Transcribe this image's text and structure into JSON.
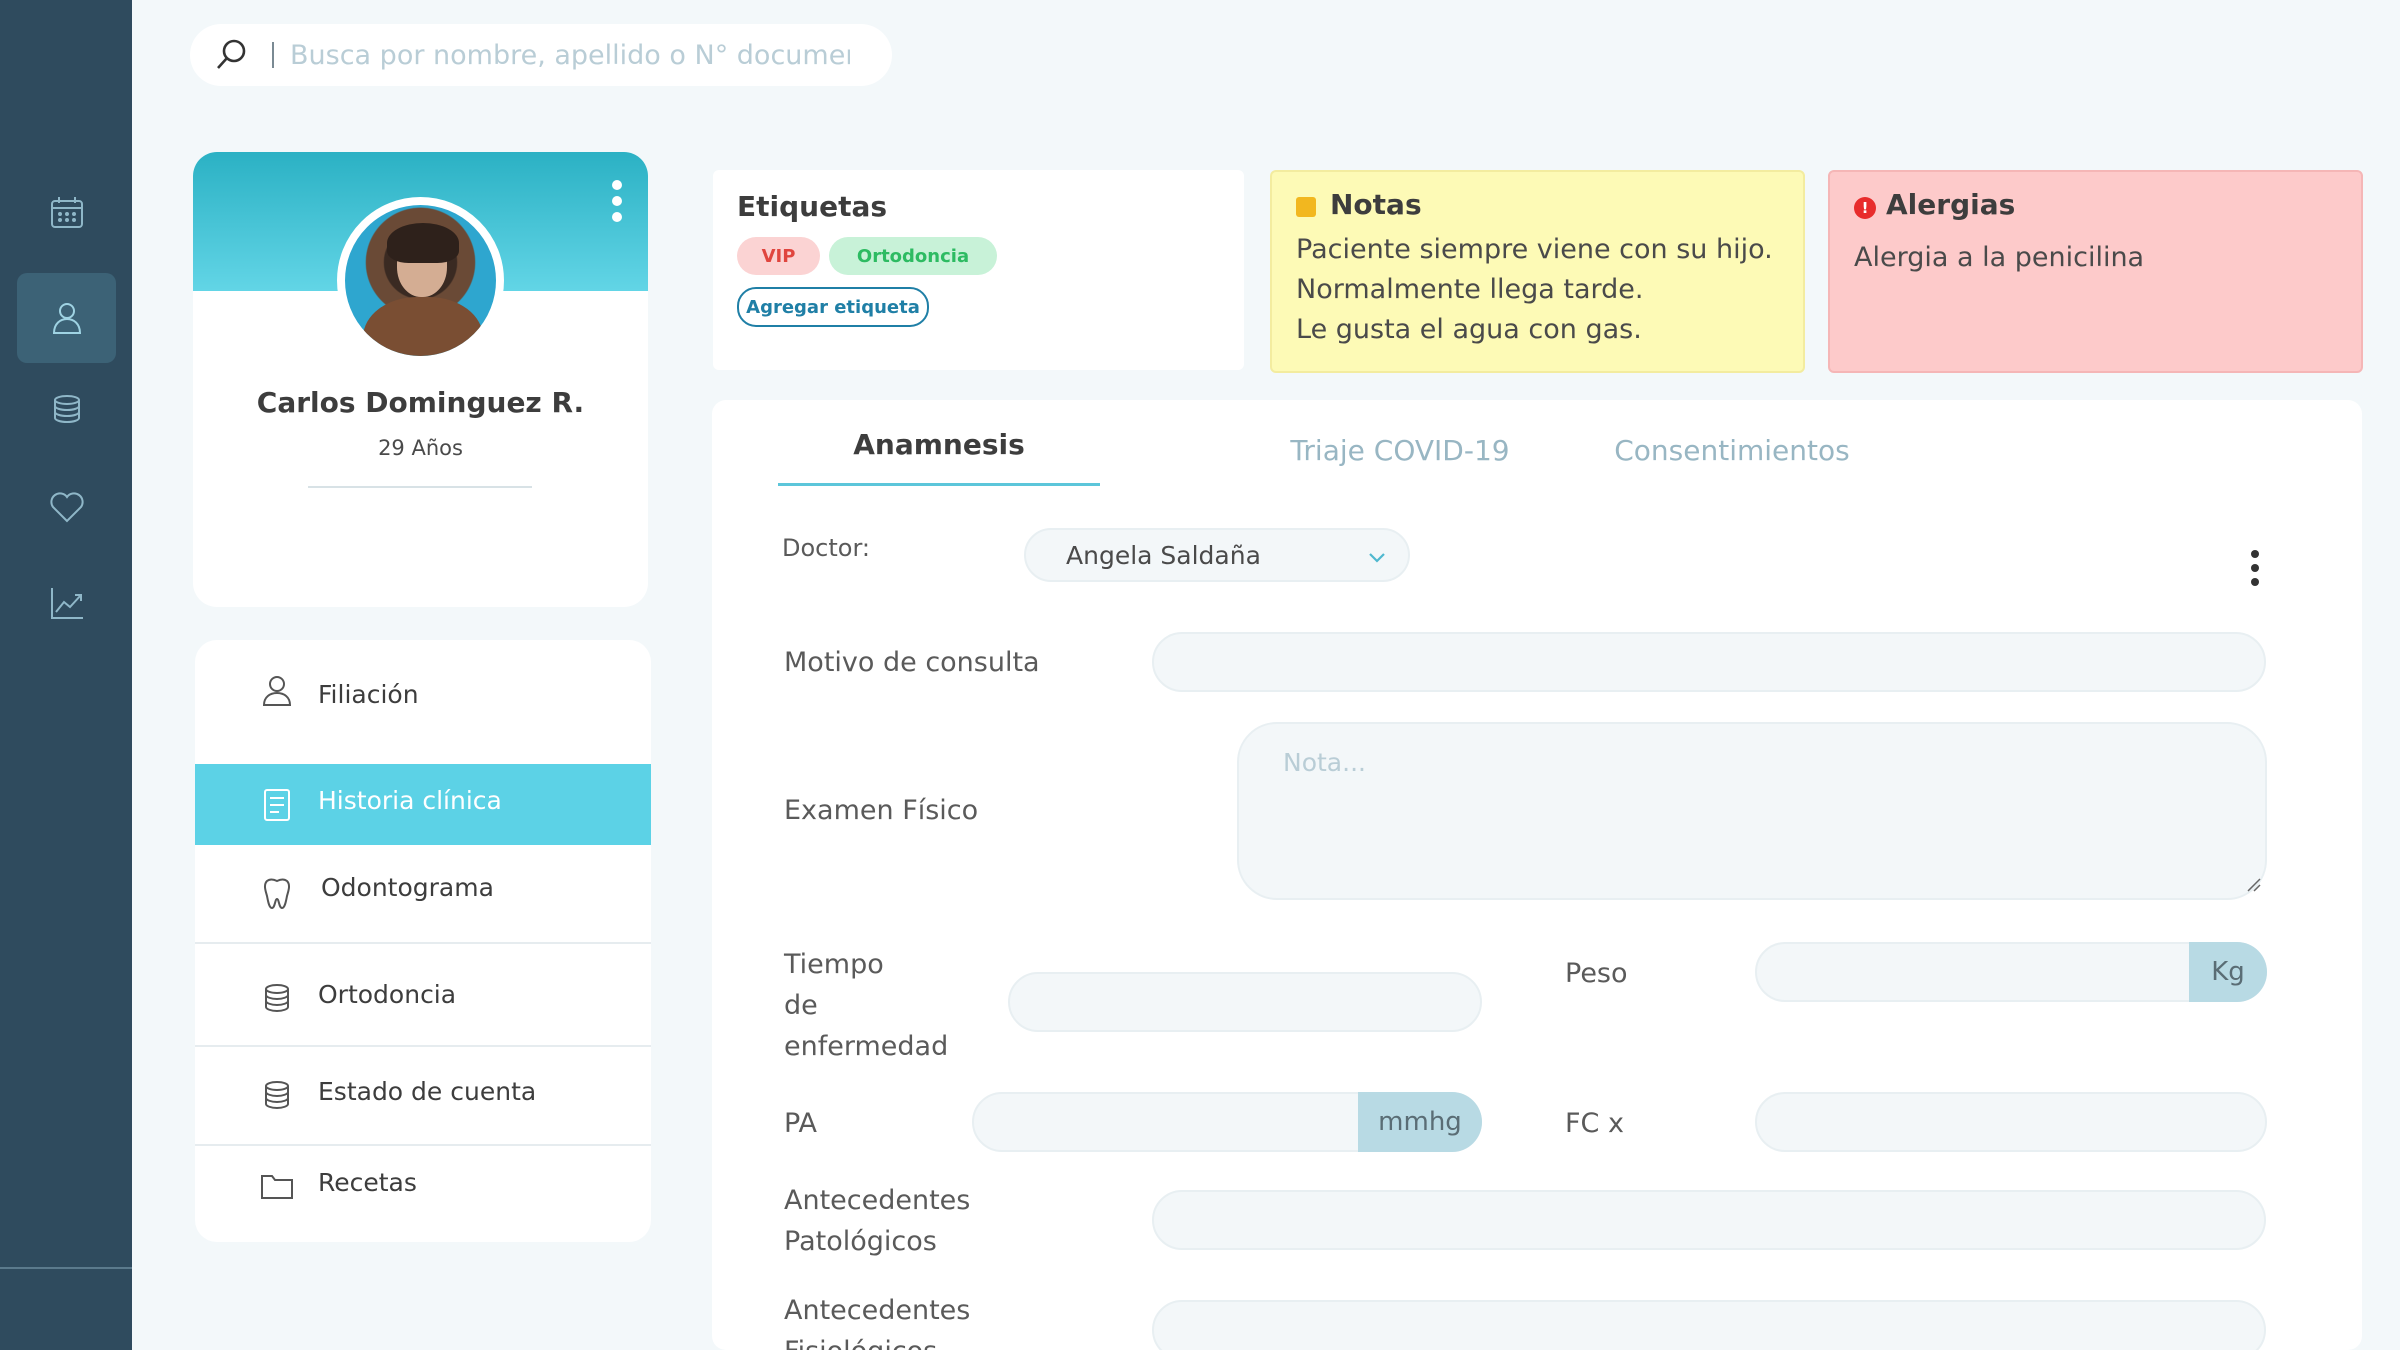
{
  "search": {
    "placeholder": "Busca por nombre, apellido o N° documento"
  },
  "rail": {
    "items": [
      {
        "icon": "calendar-icon"
      },
      {
        "icon": "user-icon",
        "active": true
      },
      {
        "icon": "coins-icon"
      },
      {
        "icon": "heart-icon"
      },
      {
        "icon": "chart-icon"
      }
    ]
  },
  "patient": {
    "name": "Carlos Dominguez R.",
    "age": "29 Años"
  },
  "menu": {
    "items": [
      {
        "label": "Filiación",
        "icon": "user-icon"
      },
      {
        "label": "Historia clínica",
        "icon": "document-icon",
        "active": true
      },
      {
        "label": "Odontograma",
        "icon": "tooth-icon"
      },
      {
        "label": "Ortodoncia",
        "icon": "coins-icon"
      },
      {
        "label": "Estado de cuenta",
        "icon": "coins-icon"
      },
      {
        "label": "Recetas",
        "icon": "folder-icon"
      }
    ]
  },
  "tags": {
    "title": "Etiquetas",
    "chips": [
      "VIP",
      "Ortodoncia"
    ],
    "add_label": "Agregar etiqueta"
  },
  "notes": {
    "title": "Notas",
    "lines": [
      "Paciente siempre viene con su hijo.",
      "Normalmente llega tarde.",
      "Le gusta el agua con gas."
    ]
  },
  "allergies": {
    "title": "Alergias",
    "text": "Alergia a la penicilina"
  },
  "tabs": [
    {
      "label": "Anamnesis",
      "active": true
    },
    {
      "label": "Triaje COVID-19"
    },
    {
      "label": "Consentimientos"
    }
  ],
  "form": {
    "doctor_label": "Doctor:",
    "doctor_value": "Angela Saldaña",
    "motivo_label": "Motivo de consulta",
    "examen_label": "Examen Físico",
    "examen_placeholder": "Nota...",
    "tiempo_label_1": "Tiempo",
    "tiempo_label_2": "de",
    "tiempo_label_3": "enfermedad",
    "peso_label": "Peso",
    "peso_unit": "Kg",
    "pa_label": "PA",
    "pa_unit": "mmhg",
    "fc_label": "FC x",
    "ant_pat_label_1": "Antecedentes",
    "ant_pat_label_2": "Patológicos",
    "ant_fis_label_1": "Antecedentes",
    "ant_fis_label_2": "Fisiológicos"
  },
  "colors": {
    "rail": "#2f4b5e",
    "accent": "#5cd2e6",
    "notes_bg": "#fdfab6",
    "allergy_bg": "#fdcaca"
  }
}
